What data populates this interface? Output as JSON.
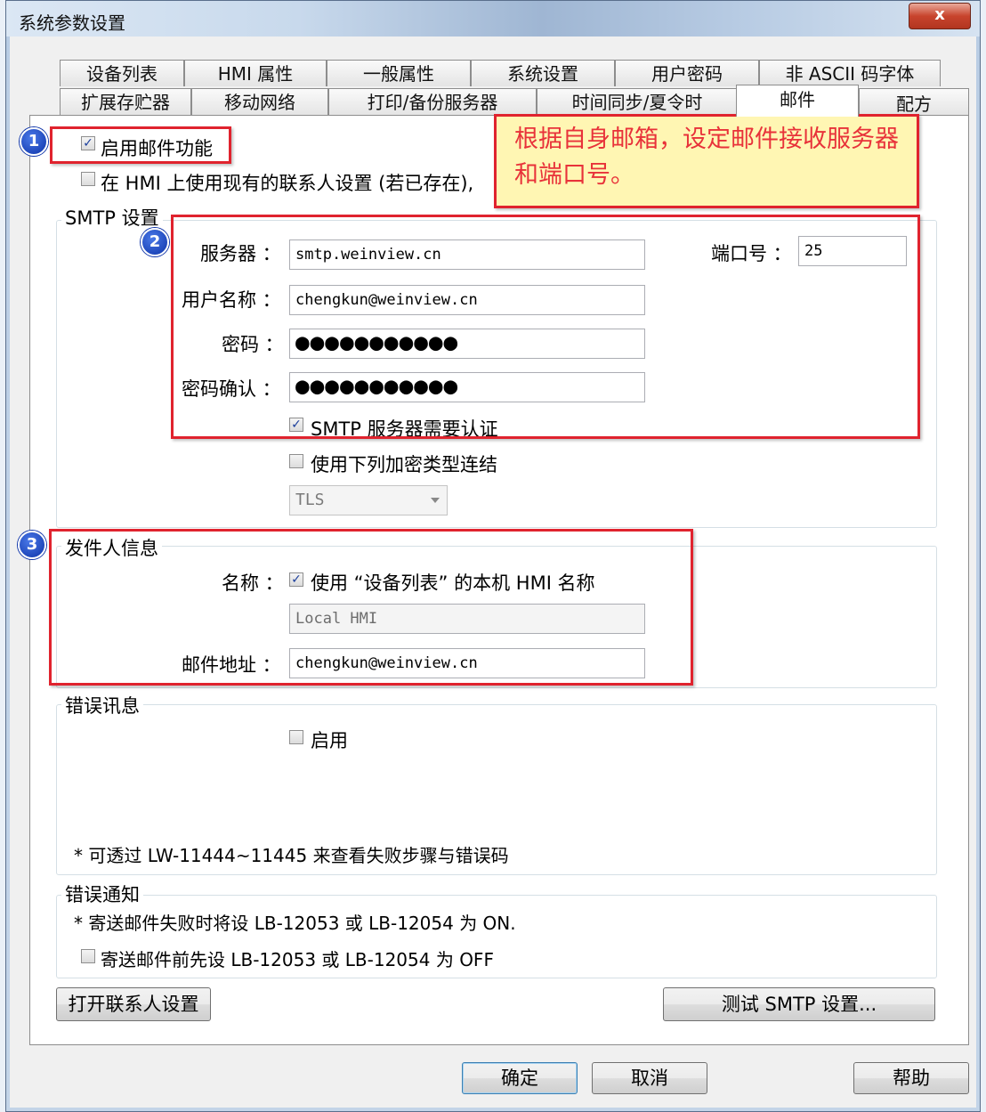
{
  "window": {
    "title": "系统参数设置",
    "close": "x"
  },
  "tabs_row1": [
    "设备列表",
    "HMI 属性",
    "一般属性",
    "系统设置",
    "用户密码",
    "非 ASCII 码字体"
  ],
  "tabs_row2": [
    "扩展存贮器",
    "移动网络",
    "打印/备份服务器",
    "时间同步/夏令时",
    "邮件",
    "配方"
  ],
  "email": {
    "enable_label": "启用邮件功能",
    "use_contacts_label": "在 HMI 上使用现有的联系人设置 (若已存在),"
  },
  "note": {
    "text": "根据自身邮箱，设定邮件接收服务器和端口号。"
  },
  "badges": [
    "1",
    "2",
    "3"
  ],
  "smtp": {
    "group_label": "SMTP 设置",
    "server_label": "服务器 ：",
    "server_value": "smtp.weinview.cn",
    "port_label": "端口号 ：",
    "port_value": "25",
    "user_label": "用户名称 ：",
    "user_value": "chengkun@weinview.cn",
    "password_label": "密码 ：",
    "password_value": "●●●●●●●●●●●",
    "confirm_label": "密码确认 ：",
    "confirm_value": "●●●●●●●●●●●",
    "auth_label": "SMTP 服务器需要认证",
    "encrypt_label": "使用下列加密类型连结",
    "encrypt_type": "TLS"
  },
  "sender": {
    "group_label": "发件人信息",
    "name_label": "名称 ：",
    "use_hmi_name_label": "使用 “设备列表” 的本机 HMI 名称",
    "name_value": "Local HMI",
    "address_label": "邮件地址 ：",
    "address_value": "chengkun@weinview.cn"
  },
  "error_msg": {
    "group_label": "错误讯息",
    "enable_label": "启用",
    "hint": "*  可透过 LW-11444~11445 来查看失败步骤与错误码"
  },
  "error_notice": {
    "group_label": "错误通知",
    "line1": "* 寄送邮件失败时将设 LB-12053 或 LB-12054 为 ON.",
    "preset_label": "寄送邮件前先设 LB-12053 或 LB-12054 为 OFF"
  },
  "buttons": {
    "open_contacts": "打开联系人设置",
    "test_smtp": "测试 SMTP 设置...",
    "ok": "确定",
    "cancel": "取消",
    "help": "帮助"
  },
  "checks": {
    "enable": true,
    "use_contacts": false,
    "auth": true,
    "encrypt": false,
    "use_hmi_name": true,
    "error_enable": false,
    "preset_off": false
  }
}
